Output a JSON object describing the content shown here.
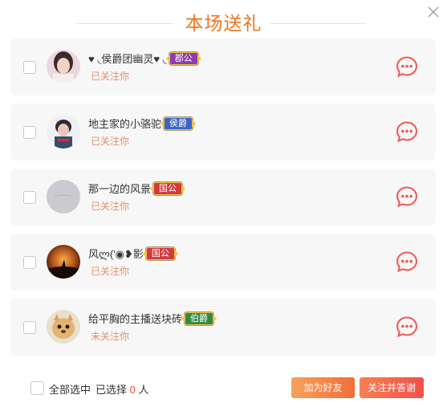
{
  "header": {
    "title": "本场送礼"
  },
  "users": [
    {
      "name": "♥ ◟侯爵团幽灵♥ ◟",
      "badge": "郡公",
      "badge_color": "#8d3bb0",
      "status": "已关注你"
    },
    {
      "name": "地主家的小骆驼",
      "badge": "侯爵",
      "badge_color": "#3b63c4",
      "status": "已关注你"
    },
    {
      "name": "那一边的风景",
      "badge": "国公",
      "badge_color": "#d23a43",
      "status": "已关注你"
    },
    {
      "name": "风ლ('◉❥影",
      "badge": "国公",
      "badge_color": "#d23a43",
      "status": "已关注你"
    },
    {
      "name": "给平胸的主播送块砖",
      "badge": "伯爵",
      "badge_color": "#2f8a48",
      "status": "未关注你"
    }
  ],
  "footer": {
    "select_all_label": "全部选中",
    "selected_prefix": "已选择",
    "selected_count": "0",
    "selected_suffix": "人",
    "add_friend_label": "加为好友",
    "follow_thank_label": "关注并答谢"
  },
  "colors": {
    "accent": "#f0741c",
    "chat_icon": "#f2574f"
  }
}
